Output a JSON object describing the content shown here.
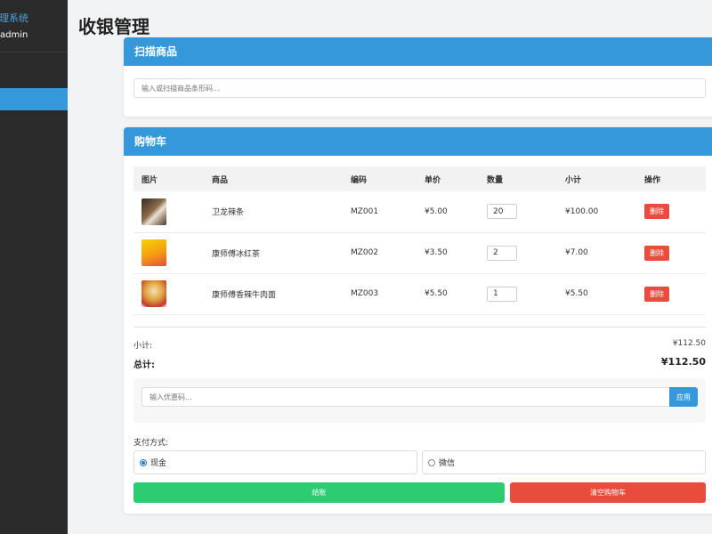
{
  "sidebar": {
    "brand": "管理系统",
    "user": "admin"
  },
  "page": {
    "title": "收银管理"
  },
  "scan": {
    "header": "扫描商品",
    "placeholder": "输入或扫描商品条形码..."
  },
  "cart": {
    "header": "购物车",
    "columns": [
      "图片",
      "商品",
      "编码",
      "单价",
      "数量",
      "小计",
      "操作"
    ],
    "rows": [
      {
        "image": "snack-product-image",
        "name": "卫龙辣条",
        "code": "MZ001",
        "price": "¥5.00",
        "qty": "20",
        "subtotal": "¥100.00",
        "action": "删除"
      },
      {
        "image": "tea-product-image",
        "name": "康师傅冰红茶",
        "code": "MZ002",
        "price": "¥3.50",
        "qty": "2",
        "subtotal": "¥7.00",
        "action": "删除"
      },
      {
        "image": "noodle-product-image",
        "name": "康师傅香辣牛肉面",
        "code": "MZ003",
        "price": "¥5.50",
        "qty": "1",
        "subtotal": "¥5.50",
        "action": "删除"
      }
    ],
    "subtotal_label": "小计:",
    "subtotal_value": "¥112.50",
    "total_label": "总计:",
    "total_value": "¥112.50"
  },
  "coupon": {
    "placeholder": "输入优惠码...",
    "apply_label": "应用"
  },
  "payment": {
    "label": "支付方式:",
    "options": [
      {
        "label": "现金",
        "selected": true
      },
      {
        "label": "微信",
        "selected": false
      }
    ]
  },
  "actions": {
    "checkout_label": "结账",
    "clear_label": "清空购物车"
  },
  "colors": {
    "primary": "#3498db",
    "success": "#2ecc71",
    "danger": "#e74c3c",
    "sidebar": "#2b2b2b"
  }
}
